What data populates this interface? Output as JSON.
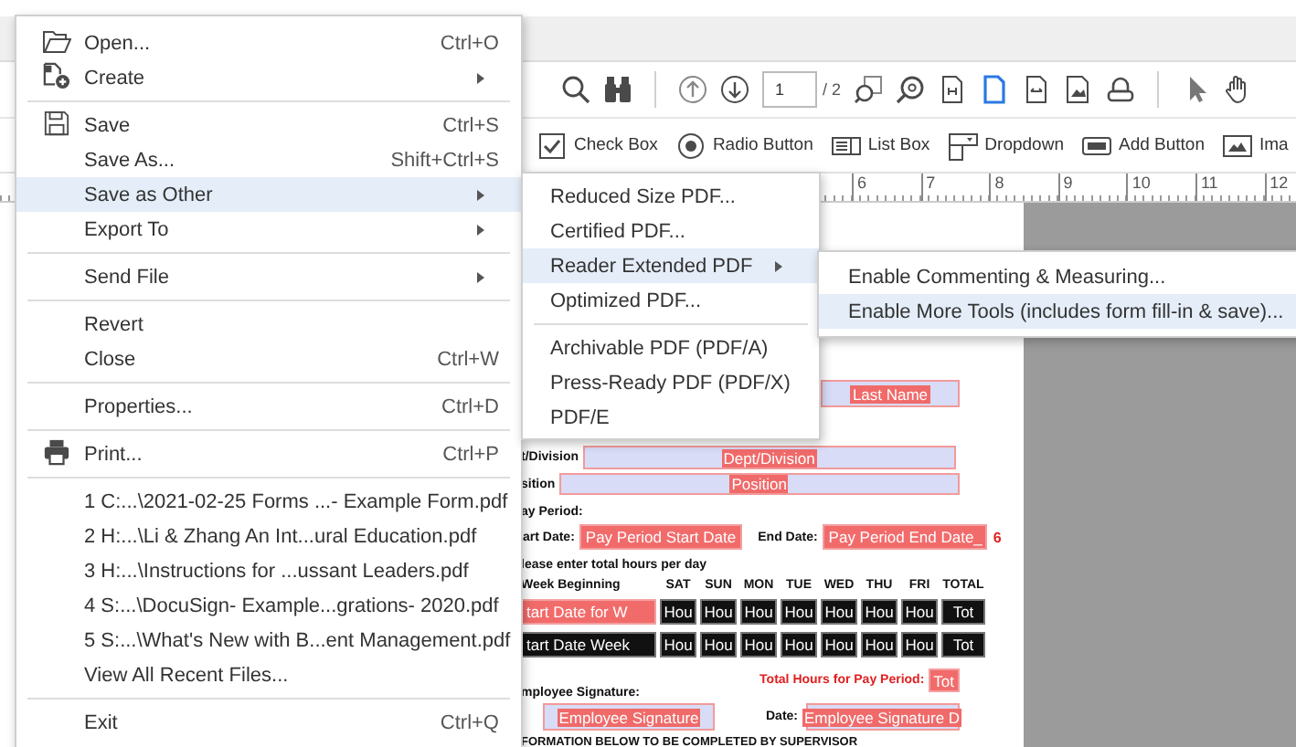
{
  "menu": {
    "items": [
      {
        "kind": "item",
        "label": "Open...",
        "shortcut": "Ctrl+O",
        "has_submenu": false,
        "selected": false
      },
      {
        "kind": "item",
        "label": "Create",
        "has_submenu": true,
        "selected": false
      },
      {
        "kind": "separator"
      },
      {
        "kind": "item",
        "label": "Save",
        "shortcut": "Ctrl+S",
        "has_submenu": false,
        "selected": false
      },
      {
        "kind": "item",
        "label": "Save As...",
        "shortcut": "Shift+Ctrl+S",
        "has_submenu": false,
        "selected": false
      },
      {
        "kind": "item",
        "label": "Save as Other",
        "has_submenu": true,
        "selected": true
      },
      {
        "kind": "item",
        "label": "Export To",
        "has_submenu": true,
        "selected": false
      },
      {
        "kind": "separator"
      },
      {
        "kind": "item",
        "label": "Send File",
        "has_submenu": true,
        "selected": false
      },
      {
        "kind": "separator"
      },
      {
        "kind": "item",
        "label": "Revert",
        "has_submenu": false,
        "selected": false
      },
      {
        "kind": "item",
        "label": "Close",
        "shortcut": "Ctrl+W",
        "has_submenu": false,
        "selected": false
      },
      {
        "kind": "separator"
      },
      {
        "kind": "item",
        "label": "Properties...",
        "shortcut": "Ctrl+D",
        "has_submenu": false,
        "selected": false
      },
      {
        "kind": "separator"
      },
      {
        "kind": "item",
        "label": "Print...",
        "shortcut": "Ctrl+P",
        "has_submenu": false,
        "selected": false
      },
      {
        "kind": "separator"
      },
      {
        "kind": "item",
        "label": "1 C:...\\2021-02-25 Forms ...- Example Form.pdf",
        "has_submenu": false,
        "selected": false
      },
      {
        "kind": "item",
        "label": "2 H:...\\Li & Zhang An Int...ural Education.pdf",
        "has_submenu": false,
        "selected": false
      },
      {
        "kind": "item",
        "label": "3 H:...\\Instructions for ...ussant Leaders.pdf",
        "has_submenu": false,
        "selected": false
      },
      {
        "kind": "item",
        "label": "4 S:...\\DocuSign- Example...grations- 2020.pdf",
        "has_submenu": false,
        "selected": false
      },
      {
        "kind": "item",
        "label": "5 S:...\\What's New with B...ent Management.pdf",
        "has_submenu": false,
        "selected": false
      },
      {
        "kind": "item",
        "label": "View All Recent Files...",
        "has_submenu": false,
        "selected": false
      },
      {
        "kind": "separator"
      },
      {
        "kind": "item",
        "label": "Exit",
        "shortcut": "Ctrl+Q",
        "has_submenu": false,
        "selected": false
      }
    ]
  },
  "save_as_other_menu": {
    "items": [
      {
        "kind": "item",
        "label": "Reduced Size PDF...",
        "has_submenu": false,
        "selected": false
      },
      {
        "kind": "item",
        "label": "Certified PDF...",
        "has_submenu": false,
        "selected": false
      },
      {
        "kind": "item",
        "label": "Reader Extended PDF",
        "has_submenu": true,
        "selected": true
      },
      {
        "kind": "item",
        "label": "Optimized PDF...",
        "has_submenu": false,
        "selected": false
      },
      {
        "kind": "separator"
      },
      {
        "kind": "item",
        "label": "Archivable PDF (PDF/A)",
        "has_submenu": false,
        "selected": false
      },
      {
        "kind": "item",
        "label": "Press-Ready PDF (PDF/X)",
        "has_submenu": false,
        "selected": false
      },
      {
        "kind": "item",
        "label": "PDF/E",
        "has_submenu": false,
        "selected": false
      }
    ]
  },
  "reader_extended_menu": {
    "items": [
      {
        "kind": "item",
        "label": "Enable Commenting & Measuring...",
        "has_submenu": false,
        "selected": false
      },
      {
        "kind": "item",
        "label": "Enable More Tools (includes form fill-in & save)...",
        "has_submenu": false,
        "selected": true
      }
    ]
  },
  "toolbar": {
    "page_field": {
      "value": "1"
    },
    "page_count": "/ 2"
  },
  "form_tools": [
    "Check Box",
    "Radio Button",
    "List Box",
    "Dropdown",
    "Add Button",
    "Ima"
  ],
  "ruler": {
    "labels": [
      "6",
      "7",
      "8",
      "9",
      "10",
      "11",
      "12"
    ]
  },
  "form": {
    "last_name_field": "Last Name",
    "dept_label": "t/Division",
    "dept_field": "Dept/Division",
    "position_label": "sition",
    "position_field": "Position",
    "pay_period_label": "ay Period:",
    "start_date_label": "art Date:",
    "start_date_field": "Pay Period Start Date",
    "end_date_label": "End Date:",
    "end_date_field": "Pay Period End Date_",
    "end_date_note": "6",
    "hours_instruction": "lease enter total hours per day",
    "week_label": "Week Beginning",
    "day_columns": [
      "SAT",
      "SUN",
      "MON",
      "TUE",
      "WED",
      "THU",
      "FRI",
      "TOTAL"
    ],
    "week_rows": [
      {
        "week_field": "tart Date for W",
        "highlighted": true,
        "hours": [
          "Hou",
          "Hou",
          "Hou",
          "Hou",
          "Hou",
          "Hou",
          "Hou"
        ],
        "total": "Tot"
      },
      {
        "week_field": "tart Date Week",
        "highlighted": false,
        "hours": [
          "Hou",
          "Hou",
          "Hou",
          "Hou",
          "Hou",
          "Hou",
          "Hou"
        ],
        "total": "Tot"
      }
    ],
    "total_hours_label": "Total Hours for Pay Period:",
    "total_hours_field": "Tot",
    "signature_label": "mployee Signature:",
    "signature_field": "Employee Signature",
    "date_label": "Date:",
    "date_field": "Employee Signature D",
    "supervisor_note": "FORMATION BELOW TO BE COMPLETED BY SUPERVISOR"
  }
}
